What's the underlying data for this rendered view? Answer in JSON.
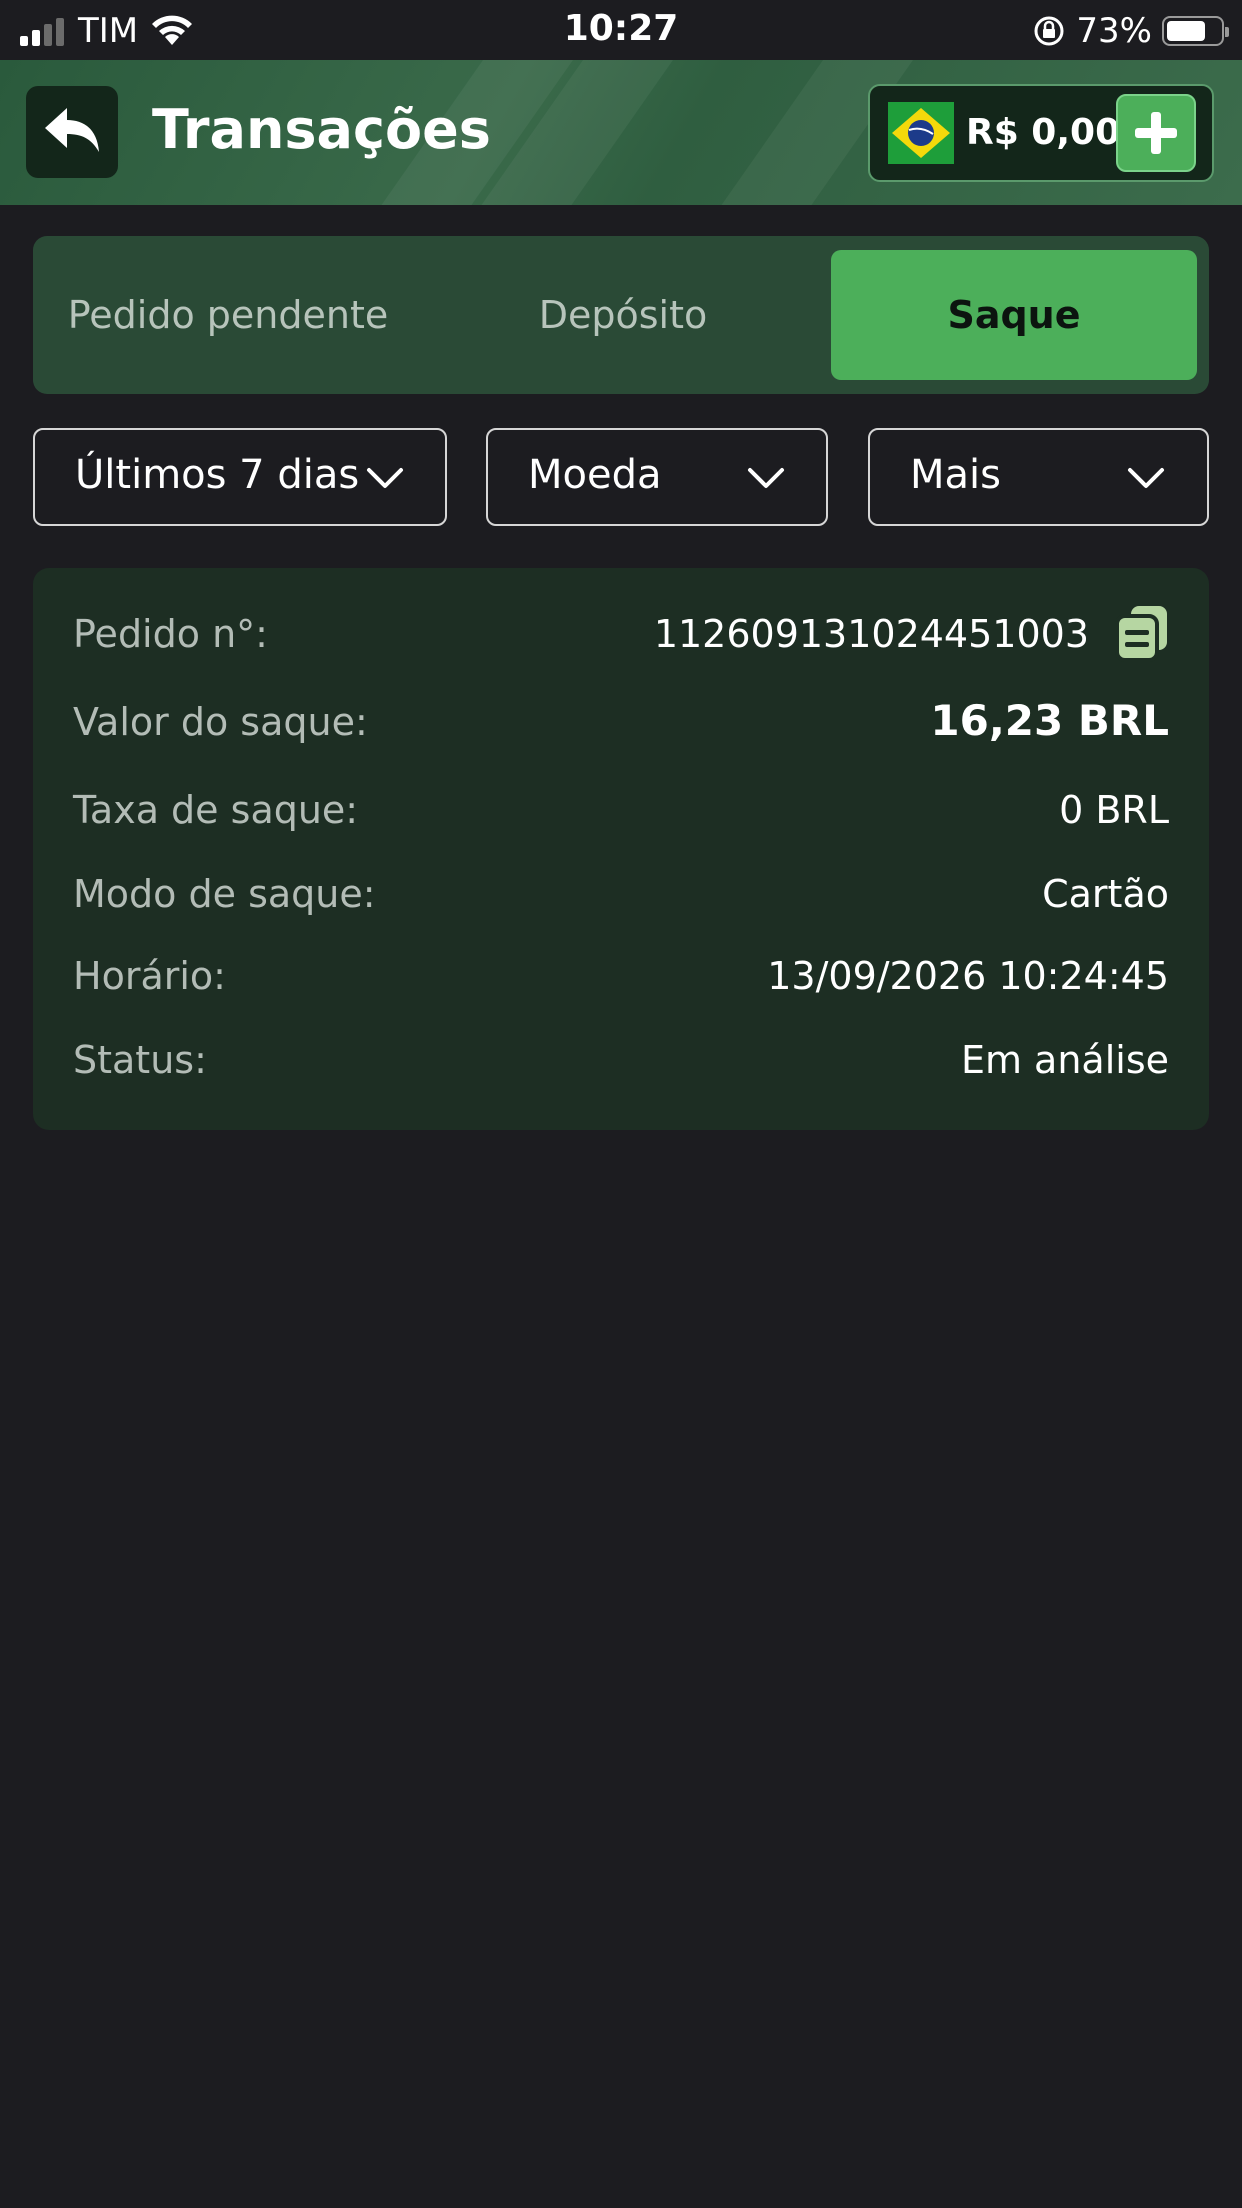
{
  "status_bar": {
    "carrier": "TIM",
    "time": "10:27",
    "battery": "73%",
    "battery_level": 0.73
  },
  "header": {
    "title": "Transações",
    "balance": "R$ 0,00",
    "icons": {
      "back": "back-arrow-icon",
      "flag": "brazil-flag-icon",
      "add": "plus-icon"
    }
  },
  "tabs": [
    {
      "label": "Pedido pendente",
      "active": false
    },
    {
      "label": "Depósito",
      "active": false
    },
    {
      "label": "Saque",
      "active": true
    }
  ],
  "filters": [
    {
      "label": "Últimos 7 dias"
    },
    {
      "label": "Moeda"
    },
    {
      "label": "Mais"
    }
  ],
  "transaction": {
    "order_label": "Pedido n°:",
    "order_value": "112609131024451003",
    "amount_label": "Valor do saque:",
    "amount_value": "16,23 BRL",
    "fee_label": "Taxa de saque:",
    "fee_value": "0 BRL",
    "mode_label": "Modo de saque:",
    "mode_value": "Cartão",
    "time_label": "Horário:",
    "time_value": "13/09/2026 10:24:45",
    "status_label": "Status:",
    "status_value": "Em análise"
  },
  "colors": {
    "background": "#1c1c20",
    "accent": "#4caf5a",
    "card": "#1d2e23",
    "tab_bar": "#2a4a36"
  }
}
